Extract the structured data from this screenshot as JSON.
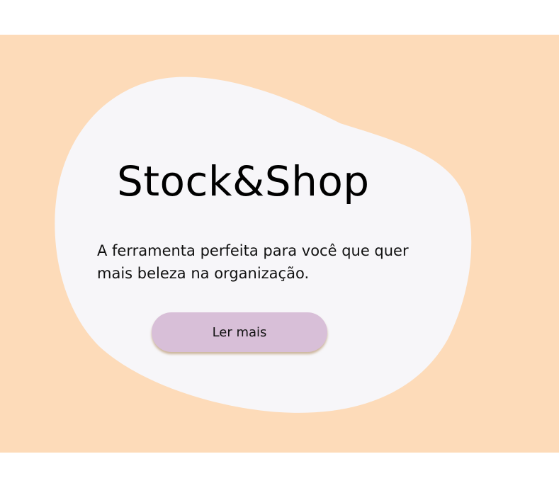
{
  "hero": {
    "title": "Stock&Shop",
    "tagline": "A ferramenta perfeita para você que quer mais beleza na organização.",
    "cta_label": "Ler mais"
  },
  "colors": {
    "background": "#ffffff",
    "banner": "#fddbb9",
    "blob": "#f7f6f9",
    "button": "#d8bfd8",
    "button_shadow": "#c49a6c"
  }
}
